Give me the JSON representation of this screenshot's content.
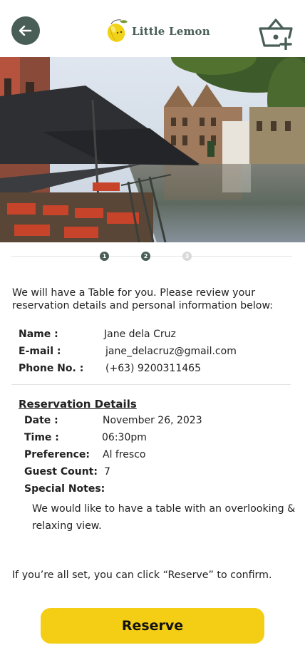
{
  "app": {
    "brand": "Little Lemon",
    "colors": {
      "primary": "#495e57",
      "accent": "#f4ce14"
    }
  },
  "header": {
    "back_icon": "back-arrow-icon",
    "logo_icon": "lemon-logo-icon",
    "cart_icon": "basket-add-icon"
  },
  "hero": {
    "image": "canal-side-restaurant-terrace-photo"
  },
  "steps": [
    {
      "label": "1",
      "state": "complete"
    },
    {
      "label": "2",
      "state": "current"
    },
    {
      "label": "3",
      "state": "pending"
    }
  ],
  "intro": "We will have a Table for you. Please review your reservation details and personal information below:",
  "personal": {
    "name_label": "Name :",
    "name_value": "Jane dela Cruz",
    "email_label": "E-mail :",
    "email_value": "jane_delacruz@gmail.com",
    "phone_label": "Phone No. :",
    "phone_value": "(+63) 9200311465"
  },
  "reservation": {
    "title": "Reservation Details",
    "date_label": "Date :",
    "date_value": "November 26, 2023",
    "time_label": "Time :",
    "time_value": "06:30pm",
    "preference_label": "Preference:",
    "preference_value": "Al fresco",
    "guest_label": "Guest Count:",
    "guest_value": "7",
    "notes_label": "Special Notes:",
    "notes_value": "We would like to have a table with an overlooking & relaxing view."
  },
  "confirm_text": "If you’re all set, you can click “Reserve” to confirm.",
  "reserve_button": "Reserve"
}
